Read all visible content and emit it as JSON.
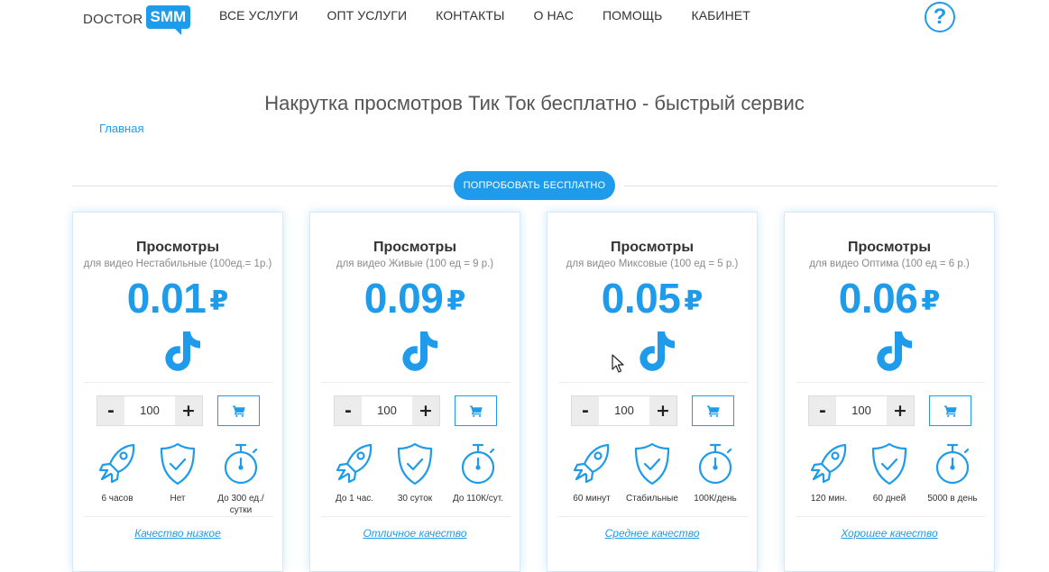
{
  "header": {
    "logo_left": "DOCTOR",
    "logo_right": "SMM",
    "nav": [
      "ВСЕ УСЛУГИ",
      "ОПТ УСЛУГИ",
      "КОНТАКТЫ",
      "О НАС",
      "ПОМОЩЬ",
      "КАБИНЕТ"
    ],
    "help_glyph": "?"
  },
  "page": {
    "title": "Накрутка просмотров Тик Ток бесплатно - быстрый сервис",
    "breadcrumb": "Главная",
    "try_button": "ПОПРОБОВАТЬ БЕСПЛАТНО"
  },
  "colors": {
    "accent": "#1e9bea"
  },
  "icons": [
    "tiktok-icon",
    "cart-icon",
    "rocket-icon",
    "shield-check-icon",
    "stopwatch-icon"
  ],
  "cards": [
    {
      "title": "Просмотры",
      "subtitle": "для видео Нестабильные (100ед.= 1р.)",
      "price": "0.01",
      "currency": "₽",
      "minus": "-",
      "plus": "+",
      "quantity": "100",
      "features": [
        "6 часов",
        "Нет",
        "До 300 ед./ сутки"
      ],
      "quality": "Качество низкое"
    },
    {
      "title": "Просмотры",
      "subtitle": "для видео Живые (100 ед = 9 р.)",
      "price": "0.09",
      "currency": "₽",
      "minus": "-",
      "plus": "+",
      "quantity": "100",
      "features": [
        "До 1 час.",
        "30 суток",
        "До 110К/сут."
      ],
      "quality": "Отличное качество"
    },
    {
      "title": "Просмотры",
      "subtitle": "для видео Миксовые (100 ед = 5 р.)",
      "price": "0.05",
      "currency": "₽",
      "minus": "-",
      "plus": "+",
      "quantity": "100",
      "features": [
        "60 минут",
        "Стабильные",
        "100К/день"
      ],
      "quality": "Среднее качество"
    },
    {
      "title": "Просмотры",
      "subtitle": "для видео Оптима (100 ед = 6 р.)",
      "price": "0.06",
      "currency": "₽",
      "minus": "-",
      "plus": "+",
      "quantity": "100",
      "features": [
        "120 мин.",
        "60 дней",
        "5000 в день"
      ],
      "quality": "Хорошее качество"
    }
  ]
}
